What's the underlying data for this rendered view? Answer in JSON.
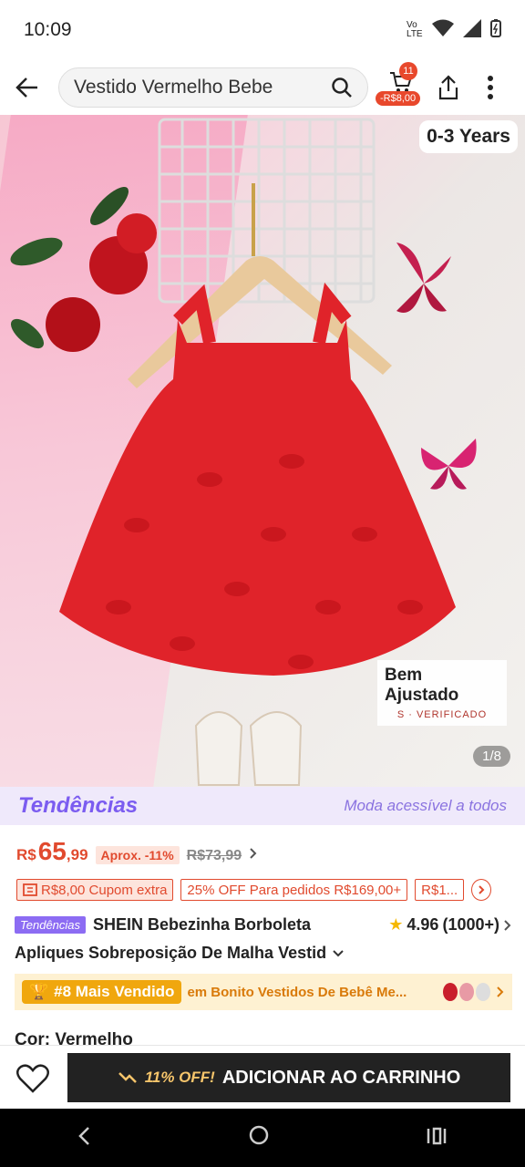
{
  "status_bar": {
    "time": "10:09",
    "volte": "Vo LTE"
  },
  "header": {
    "search_text": "Vestido Vermelho Bebe",
    "cart_count": "11",
    "cart_discount": "-R$8,00"
  },
  "gallery": {
    "age_label": "0-3 Years",
    "fit_label": "Bem Ajustado",
    "fit_sub": "S · VERIFICADO",
    "counter": "1/8"
  },
  "trends": {
    "brand": "Tendências",
    "tagline": "Moda acessível a todos"
  },
  "price": {
    "currency": "R$",
    "value": "65",
    "cents": ",99",
    "aprox_label": "Aprox. -11%",
    "old_price": "R$73,99"
  },
  "coupons": [
    "R$8,00 Cupom extra",
    "25% OFF Para pedidos R$169,00+",
    "R$1..."
  ],
  "product": {
    "tag": "Tendências",
    "name_line1": "SHEIN Bebezinha Borboleta",
    "name_line2": "Apliques Sobreposição De Malha Vestid",
    "rating": "4.96",
    "reviews": "(1000+)"
  },
  "best_seller": {
    "rank": "#8 Mais Vendido",
    "category": "em Bonito Vestidos De Bebê Me..."
  },
  "color_label": "Cor: Vermelho",
  "footer": {
    "discount": "11% OFF!",
    "add_to_cart": "ADICIONAR AO CARRINHO"
  },
  "colors": {
    "accent": "#e14a2e",
    "trend_purple": "#7b5cf0",
    "gold": "#f0a70e"
  }
}
